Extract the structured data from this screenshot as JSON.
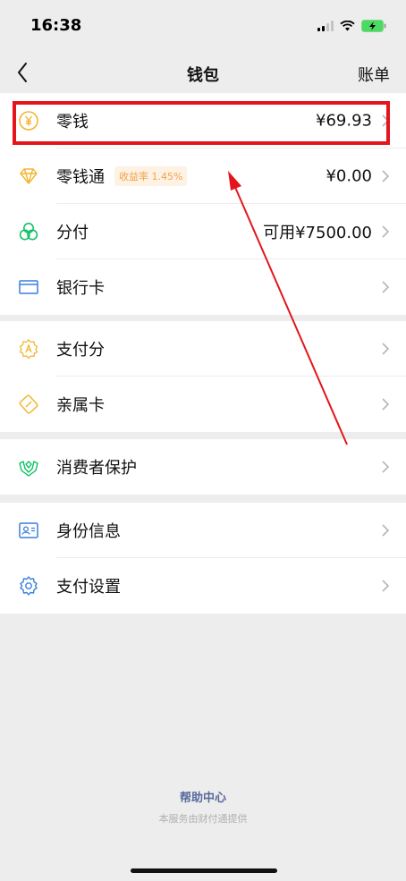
{
  "status_bar": {
    "time": "16:38"
  },
  "nav": {
    "title": "钱包",
    "right_label": "账单"
  },
  "groups": [
    [
      {
        "label": "零钱",
        "value": "¥69.93",
        "icon": "coin-icon"
      },
      {
        "label": "零钱通",
        "badge": "收益率 1.45%",
        "value": "¥0.00",
        "icon": "diamond-icon"
      },
      {
        "label": "分付",
        "value": "可用¥7500.00",
        "icon": "rings-icon"
      },
      {
        "label": "银行卡",
        "value": "",
        "icon": "card-icon"
      }
    ],
    [
      {
        "label": "支付分",
        "value": "",
        "icon": "badge-score-icon"
      },
      {
        "label": "亲属卡",
        "value": "",
        "icon": "family-card-icon"
      }
    ],
    [
      {
        "label": "消费者保护",
        "value": "",
        "icon": "shield-hands-icon"
      }
    ],
    [
      {
        "label": "身份信息",
        "value": "",
        "icon": "id-card-icon"
      },
      {
        "label": "支付设置",
        "value": "",
        "icon": "settings-gear-icon"
      }
    ]
  ],
  "footer": {
    "help_center": "帮助中心",
    "provider_note": "本服务由财付通提供"
  },
  "colors": {
    "accent_yellow": "#f3b52f",
    "accent_green": "#07c160",
    "accent_blue": "#3a7fe0",
    "annotation_red": "#e4161c",
    "footer_link": "#57699a"
  }
}
